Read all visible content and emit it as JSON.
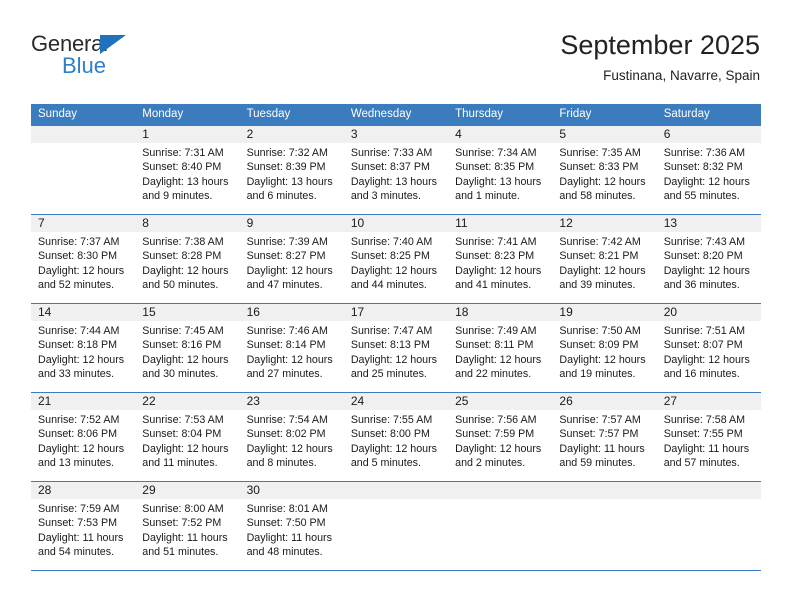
{
  "brand": {
    "word_general": "General",
    "word_blue": "Blue",
    "accent_color": "#2f7fc4",
    "triangle_color": "#1f72bd"
  },
  "header": {
    "title": "September 2025",
    "subtitle": "Fustinana, Navarre, Spain",
    "header_band_color": "#3a7cbe",
    "number_band_color": "#f0f0f0"
  },
  "weekdays": [
    "Sunday",
    "Monday",
    "Tuesday",
    "Wednesday",
    "Thursday",
    "Friday",
    "Saturday"
  ],
  "weeks": [
    {
      "days": [
        {
          "num": "",
          "l1": "",
          "l2": "",
          "l3": "",
          "l4": ""
        },
        {
          "num": "1",
          "l1": "Sunrise: 7:31 AM",
          "l2": "Sunset: 8:40 PM",
          "l3": "Daylight: 13 hours",
          "l4": "and 9 minutes."
        },
        {
          "num": "2",
          "l1": "Sunrise: 7:32 AM",
          "l2": "Sunset: 8:39 PM",
          "l3": "Daylight: 13 hours",
          "l4": "and 6 minutes."
        },
        {
          "num": "3",
          "l1": "Sunrise: 7:33 AM",
          "l2": "Sunset: 8:37 PM",
          "l3": "Daylight: 13 hours",
          "l4": "and 3 minutes."
        },
        {
          "num": "4",
          "l1": "Sunrise: 7:34 AM",
          "l2": "Sunset: 8:35 PM",
          "l3": "Daylight: 13 hours",
          "l4": "and 1 minute."
        },
        {
          "num": "5",
          "l1": "Sunrise: 7:35 AM",
          "l2": "Sunset: 8:33 PM",
          "l3": "Daylight: 12 hours",
          "l4": "and 58 minutes."
        },
        {
          "num": "6",
          "l1": "Sunrise: 7:36 AM",
          "l2": "Sunset: 8:32 PM",
          "l3": "Daylight: 12 hours",
          "l4": "and 55 minutes."
        }
      ]
    },
    {
      "days": [
        {
          "num": "7",
          "l1": "Sunrise: 7:37 AM",
          "l2": "Sunset: 8:30 PM",
          "l3": "Daylight: 12 hours",
          "l4": "and 52 minutes."
        },
        {
          "num": "8",
          "l1": "Sunrise: 7:38 AM",
          "l2": "Sunset: 8:28 PM",
          "l3": "Daylight: 12 hours",
          "l4": "and 50 minutes."
        },
        {
          "num": "9",
          "l1": "Sunrise: 7:39 AM",
          "l2": "Sunset: 8:27 PM",
          "l3": "Daylight: 12 hours",
          "l4": "and 47 minutes."
        },
        {
          "num": "10",
          "l1": "Sunrise: 7:40 AM",
          "l2": "Sunset: 8:25 PM",
          "l3": "Daylight: 12 hours",
          "l4": "and 44 minutes."
        },
        {
          "num": "11",
          "l1": "Sunrise: 7:41 AM",
          "l2": "Sunset: 8:23 PM",
          "l3": "Daylight: 12 hours",
          "l4": "and 41 minutes."
        },
        {
          "num": "12",
          "l1": "Sunrise: 7:42 AM",
          "l2": "Sunset: 8:21 PM",
          "l3": "Daylight: 12 hours",
          "l4": "and 39 minutes."
        },
        {
          "num": "13",
          "l1": "Sunrise: 7:43 AM",
          "l2": "Sunset: 8:20 PM",
          "l3": "Daylight: 12 hours",
          "l4": "and 36 minutes."
        }
      ]
    },
    {
      "days": [
        {
          "num": "14",
          "l1": "Sunrise: 7:44 AM",
          "l2": "Sunset: 8:18 PM",
          "l3": "Daylight: 12 hours",
          "l4": "and 33 minutes."
        },
        {
          "num": "15",
          "l1": "Sunrise: 7:45 AM",
          "l2": "Sunset: 8:16 PM",
          "l3": "Daylight: 12 hours",
          "l4": "and 30 minutes."
        },
        {
          "num": "16",
          "l1": "Sunrise: 7:46 AM",
          "l2": "Sunset: 8:14 PM",
          "l3": "Daylight: 12 hours",
          "l4": "and 27 minutes."
        },
        {
          "num": "17",
          "l1": "Sunrise: 7:47 AM",
          "l2": "Sunset: 8:13 PM",
          "l3": "Daylight: 12 hours",
          "l4": "and 25 minutes."
        },
        {
          "num": "18",
          "l1": "Sunrise: 7:49 AM",
          "l2": "Sunset: 8:11 PM",
          "l3": "Daylight: 12 hours",
          "l4": "and 22 minutes."
        },
        {
          "num": "19",
          "l1": "Sunrise: 7:50 AM",
          "l2": "Sunset: 8:09 PM",
          "l3": "Daylight: 12 hours",
          "l4": "and 19 minutes."
        },
        {
          "num": "20",
          "l1": "Sunrise: 7:51 AM",
          "l2": "Sunset: 8:07 PM",
          "l3": "Daylight: 12 hours",
          "l4": "and 16 minutes."
        }
      ]
    },
    {
      "days": [
        {
          "num": "21",
          "l1": "Sunrise: 7:52 AM",
          "l2": "Sunset: 8:06 PM",
          "l3": "Daylight: 12 hours",
          "l4": "and 13 minutes."
        },
        {
          "num": "22",
          "l1": "Sunrise: 7:53 AM",
          "l2": "Sunset: 8:04 PM",
          "l3": "Daylight: 12 hours",
          "l4": "and 11 minutes."
        },
        {
          "num": "23",
          "l1": "Sunrise: 7:54 AM",
          "l2": "Sunset: 8:02 PM",
          "l3": "Daylight: 12 hours",
          "l4": "and 8 minutes."
        },
        {
          "num": "24",
          "l1": "Sunrise: 7:55 AM",
          "l2": "Sunset: 8:00 PM",
          "l3": "Daylight: 12 hours",
          "l4": "and 5 minutes."
        },
        {
          "num": "25",
          "l1": "Sunrise: 7:56 AM",
          "l2": "Sunset: 7:59 PM",
          "l3": "Daylight: 12 hours",
          "l4": "and 2 minutes."
        },
        {
          "num": "26",
          "l1": "Sunrise: 7:57 AM",
          "l2": "Sunset: 7:57 PM",
          "l3": "Daylight: 11 hours",
          "l4": "and 59 minutes."
        },
        {
          "num": "27",
          "l1": "Sunrise: 7:58 AM",
          "l2": "Sunset: 7:55 PM",
          "l3": "Daylight: 11 hours",
          "l4": "and 57 minutes."
        }
      ]
    },
    {
      "days": [
        {
          "num": "28",
          "l1": "Sunrise: 7:59 AM",
          "l2": "Sunset: 7:53 PM",
          "l3": "Daylight: 11 hours",
          "l4": "and 54 minutes."
        },
        {
          "num": "29",
          "l1": "Sunrise: 8:00 AM",
          "l2": "Sunset: 7:52 PM",
          "l3": "Daylight: 11 hours",
          "l4": "and 51 minutes."
        },
        {
          "num": "30",
          "l1": "Sunrise: 8:01 AM",
          "l2": "Sunset: 7:50 PM",
          "l3": "Daylight: 11 hours",
          "l4": "and 48 minutes."
        },
        {
          "num": "",
          "l1": "",
          "l2": "",
          "l3": "",
          "l4": ""
        },
        {
          "num": "",
          "l1": "",
          "l2": "",
          "l3": "",
          "l4": ""
        },
        {
          "num": "",
          "l1": "",
          "l2": "",
          "l3": "",
          "l4": ""
        },
        {
          "num": "",
          "l1": "",
          "l2": "",
          "l3": "",
          "l4": ""
        }
      ]
    }
  ]
}
